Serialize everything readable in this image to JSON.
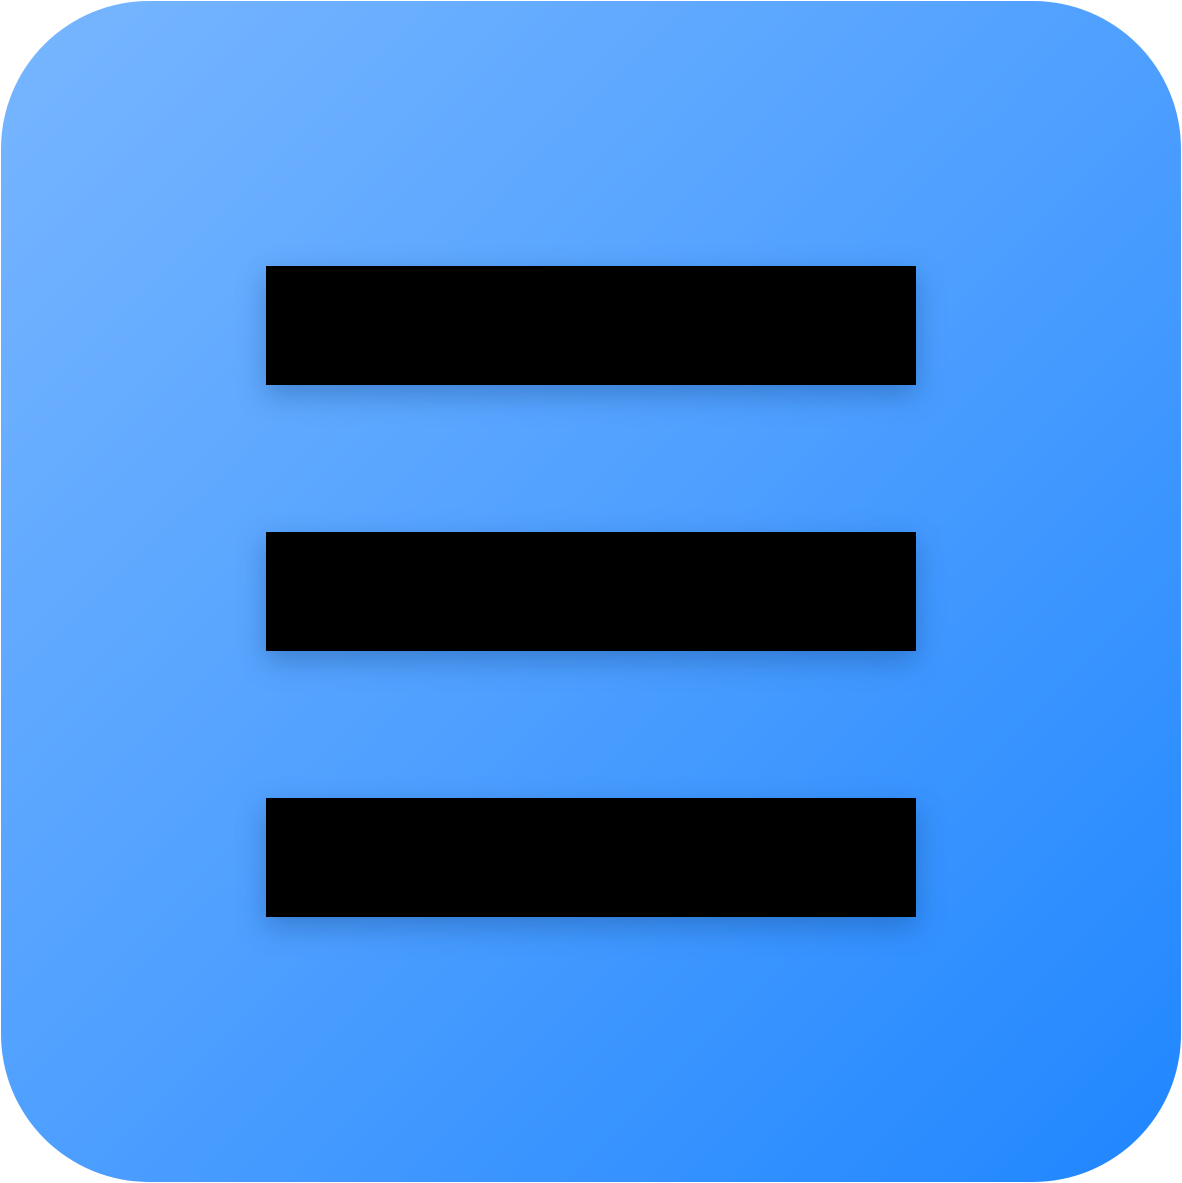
{
  "icon": {
    "name": "hamburger-menu-icon",
    "colors": {
      "gradient_start": "#78b6ff",
      "gradient_mid": "#4a9dff",
      "gradient_end": "#1f86ff",
      "bar": "#000000"
    }
  }
}
